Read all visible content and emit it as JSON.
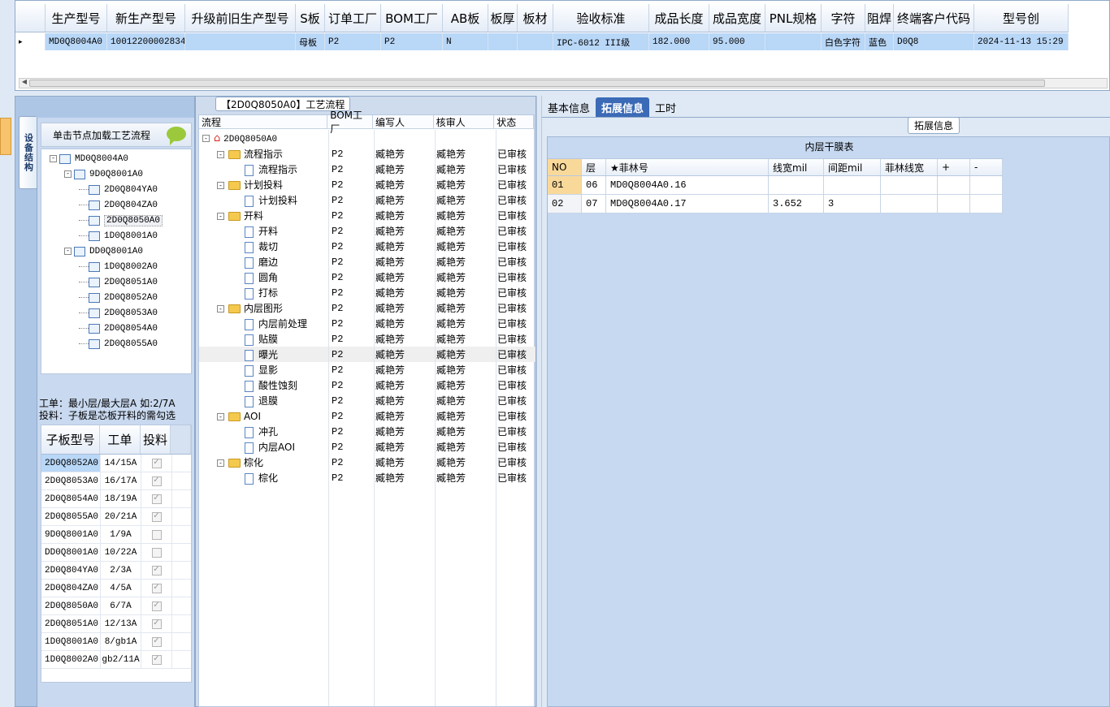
{
  "top_grid": {
    "columns": [
      "生产型号",
      "新生产型号",
      "升级前旧生产型号",
      "S板",
      "订单工厂",
      "BOM工厂",
      "AB板",
      "板厚",
      "板材",
      "验收标准",
      "成品长度",
      "成品宽度",
      "PNL规格",
      "字符",
      "阻焊",
      "终端客户代码",
      "型号创"
    ],
    "row": [
      "MD0Q8004A0",
      "10012200002834",
      "",
      "母板",
      "P2",
      "P2",
      "N",
      "",
      "",
      "IPC-6012 III级",
      "182.000",
      "95.000",
      "",
      "白色字符",
      "蓝色",
      "D0Q8",
      "2024-11-13 15:29"
    ]
  },
  "sidebar": {
    "vertical_tab": "设备结构",
    "load_hint": "单击节点加载工艺流程",
    "tree": [
      {
        "label": "MD0Q8004A0",
        "level": 0,
        "exp": "-"
      },
      {
        "label": "9D0Q8001A0",
        "level": 1,
        "exp": "-"
      },
      {
        "label": "2D0Q804YA0",
        "level": 2
      },
      {
        "label": "2D0Q804ZA0",
        "level": 2
      },
      {
        "label": "2D0Q8050A0",
        "level": 2,
        "selected": true
      },
      {
        "label": "1D0Q8001A0",
        "level": 2
      },
      {
        "label": "DD0Q8001A0",
        "level": 1,
        "exp": "-"
      },
      {
        "label": "1D0Q8002A0",
        "level": 2
      },
      {
        "label": "2D0Q8051A0",
        "level": 2
      },
      {
        "label": "2D0Q8052A0",
        "level": 2
      },
      {
        "label": "2D0Q8053A0",
        "level": 2
      },
      {
        "label": "2D0Q8054A0",
        "level": 2
      },
      {
        "label": "2D0Q8055A0",
        "level": 2
      }
    ],
    "hint_line1": "工单：最小层/最大层A 如:2/7A",
    "hint_line2": "投料：子板是芯板开料的需勾选",
    "sub_grid": {
      "columns": [
        "子板型号",
        "工单",
        "投料"
      ],
      "rows": [
        [
          "2D0Q8052A0",
          "14/15A",
          true
        ],
        [
          "2D0Q8053A0",
          "16/17A",
          true
        ],
        [
          "2D0Q8054A0",
          "18/19A",
          true
        ],
        [
          "2D0Q8055A0",
          "20/21A",
          true
        ],
        [
          "9D0Q8001A0",
          "1/9A",
          false
        ],
        [
          "DD0Q8001A0",
          "10/22A",
          false
        ],
        [
          "2D0Q804YA0",
          "2/3A",
          true
        ],
        [
          "2D0Q804ZA0",
          "4/5A",
          true
        ],
        [
          "2D0Q8050A0",
          "6/7A",
          true
        ],
        [
          "2D0Q8051A0",
          "12/13A",
          true
        ],
        [
          "1D0Q8001A0",
          "8/gb1A",
          true
        ],
        [
          "1D0Q8002A0",
          "gb2/11A",
          true
        ]
      ]
    }
  },
  "process": {
    "title": "【2D0Q8050A0】工艺流程",
    "columns": [
      "流程",
      "BOM工厂",
      "编写人",
      "核审人",
      "状态"
    ],
    "root": "2D0Q8050A0",
    "rows": [
      {
        "name": "流程指示",
        "kind": "folder",
        "bom": "P2",
        "writer": "臧艳芳",
        "reviewer": "臧艳芳",
        "status": "已审核"
      },
      {
        "name": "流程指示",
        "kind": "doc",
        "bom": "P2",
        "writer": "臧艳芳",
        "reviewer": "臧艳芳",
        "status": "已审核"
      },
      {
        "name": "计划投料",
        "kind": "folder",
        "bom": "P2",
        "writer": "臧艳芳",
        "reviewer": "臧艳芳",
        "status": "已审核"
      },
      {
        "name": "计划投料",
        "kind": "doc",
        "bom": "P2",
        "writer": "臧艳芳",
        "reviewer": "臧艳芳",
        "status": "已审核"
      },
      {
        "name": "开料",
        "kind": "folder",
        "bom": "P2",
        "writer": "臧艳芳",
        "reviewer": "臧艳芳",
        "status": "已审核"
      },
      {
        "name": "开料",
        "kind": "doc",
        "bom": "P2",
        "writer": "臧艳芳",
        "reviewer": "臧艳芳",
        "status": "已审核"
      },
      {
        "name": "裁切",
        "kind": "doc",
        "bom": "P2",
        "writer": "臧艳芳",
        "reviewer": "臧艳芳",
        "status": "已审核"
      },
      {
        "name": "磨边",
        "kind": "doc",
        "bom": "P2",
        "writer": "臧艳芳",
        "reviewer": "臧艳芳",
        "status": "已审核"
      },
      {
        "name": "圆角",
        "kind": "doc",
        "bom": "P2",
        "writer": "臧艳芳",
        "reviewer": "臧艳芳",
        "status": "已审核"
      },
      {
        "name": "打标",
        "kind": "doc",
        "bom": "P2",
        "writer": "臧艳芳",
        "reviewer": "臧艳芳",
        "status": "已审核"
      },
      {
        "name": "内层图形",
        "kind": "folder",
        "bom": "P2",
        "writer": "臧艳芳",
        "reviewer": "臧艳芳",
        "status": "已审核"
      },
      {
        "name": "内层前处理",
        "kind": "doc",
        "bom": "P2",
        "writer": "臧艳芳",
        "reviewer": "臧艳芳",
        "status": "已审核"
      },
      {
        "name": "贴膜",
        "kind": "doc",
        "bom": "P2",
        "writer": "臧艳芳",
        "reviewer": "臧艳芳",
        "status": "已审核"
      },
      {
        "name": "曝光",
        "kind": "doc",
        "bom": "P2",
        "writer": "臧艳芳",
        "reviewer": "臧艳芳",
        "status": "已审核",
        "selected": true
      },
      {
        "name": "显影",
        "kind": "doc",
        "bom": "P2",
        "writer": "臧艳芳",
        "reviewer": "臧艳芳",
        "status": "已审核"
      },
      {
        "name": "酸性蚀刻",
        "kind": "doc",
        "bom": "P2",
        "writer": "臧艳芳",
        "reviewer": "臧艳芳",
        "status": "已审核"
      },
      {
        "name": "退膜",
        "kind": "doc",
        "bom": "P2",
        "writer": "臧艳芳",
        "reviewer": "臧艳芳",
        "status": "已审核"
      },
      {
        "name": "AOI",
        "kind": "folder",
        "bom": "P2",
        "writer": "臧艳芳",
        "reviewer": "臧艳芳",
        "status": "已审核"
      },
      {
        "name": "冲孔",
        "kind": "doc",
        "bom": "P2",
        "writer": "臧艳芳",
        "reviewer": "臧艳芳",
        "status": "已审核"
      },
      {
        "name": "内层AOI",
        "kind": "doc",
        "bom": "P2",
        "writer": "臧艳芳",
        "reviewer": "臧艳芳",
        "status": "已审核"
      },
      {
        "name": "棕化",
        "kind": "folder",
        "bom": "P2",
        "writer": "臧艳芳",
        "reviewer": "臧艳芳",
        "status": "已审核"
      },
      {
        "name": "棕化",
        "kind": "doc",
        "bom": "P2",
        "writer": "臧艳芳",
        "reviewer": "臧艳芳",
        "status": "已审核"
      }
    ]
  },
  "right": {
    "tabs": [
      {
        "label": "基本信息",
        "active": false
      },
      {
        "label": "拓展信息",
        "active": true
      },
      {
        "label": "工时",
        "active": false
      }
    ],
    "ext_button": "拓展信息",
    "film_title": "内层干膜表",
    "film_columns": [
      "NO",
      "层",
      "★菲林号",
      "线宽mil",
      "间距mil",
      "菲林线宽",
      "+",
      "-"
    ],
    "film_rows": [
      [
        "01",
        "06",
        "MD0Q8004A0.16",
        "",
        "",
        "",
        "",
        ""
      ],
      [
        "02",
        "07",
        "MD0Q8004A0.17",
        "3.652",
        "3",
        "",
        "",
        ""
      ]
    ]
  }
}
